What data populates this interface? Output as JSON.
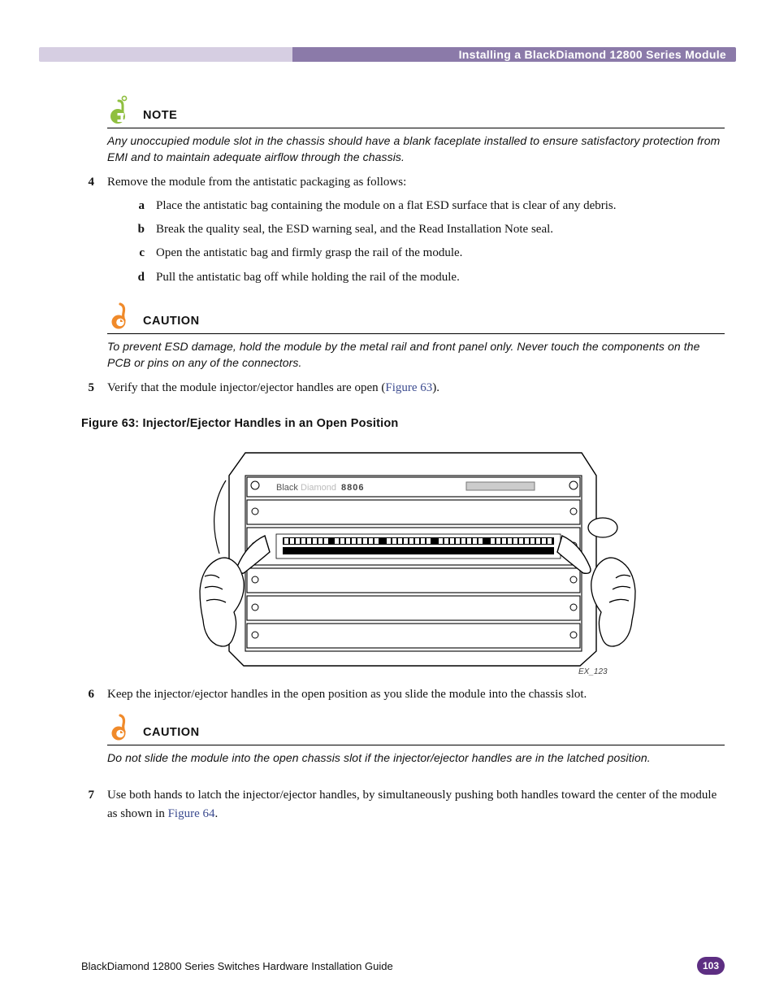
{
  "header": {
    "title": "Installing a BlackDiamond 12800 Series Module"
  },
  "note1": {
    "label": "NOTE",
    "text": "Any unoccupied module slot in the chassis should have a blank faceplate installed to ensure satisfactory protection from EMI and to maintain adequate airflow through the chassis."
  },
  "steps": {
    "s4": {
      "num": "4",
      "text": "Remove the module from the antistatic packaging as follows:",
      "sub": {
        "a": {
          "num": "a",
          "text": "Place the antistatic bag containing the module on a flat ESD surface that is clear of any debris."
        },
        "b": {
          "num": "b",
          "text": "Break the quality seal, the ESD warning seal, and the Read Installation Note seal."
        },
        "c": {
          "num": "c",
          "text": "Open the antistatic bag and firmly grasp the rail of the module."
        },
        "d": {
          "num": "d",
          "text": "Pull the antistatic bag off while holding the rail of the module."
        }
      }
    },
    "s5": {
      "num": "5",
      "pre": "Verify that the module injector/ejector handles are open (",
      "link": "Figure 63",
      "post": ")."
    },
    "s6": {
      "num": "6",
      "text": "Keep the injector/ejector handles in the open position as you slide the module into the chassis slot."
    },
    "s7": {
      "num": "7",
      "pre": "Use both hands to latch the injector/ejector handles, by simultaneously pushing both handles toward the center of the module as shown in ",
      "link": "Figure 64",
      "post": "."
    }
  },
  "caution1": {
    "label": "CAUTION",
    "text": "To prevent ESD damage, hold the module by the metal rail and front panel only. Never touch the components on the PCB or pins on any of the connectors."
  },
  "figure63": {
    "caption": "Figure 63:  Injector/Ejector Handles in an Open Position",
    "device_label": "BlackDiamond 8806",
    "ref": "EX_123"
  },
  "caution2": {
    "label": "CAUTION",
    "text": "Do not slide the module into the open chassis slot if the injector/ejector handles are in the latched position."
  },
  "footer": {
    "text": "BlackDiamond 12800 Series Switches Hardware Installation Guide",
    "page": "103"
  }
}
